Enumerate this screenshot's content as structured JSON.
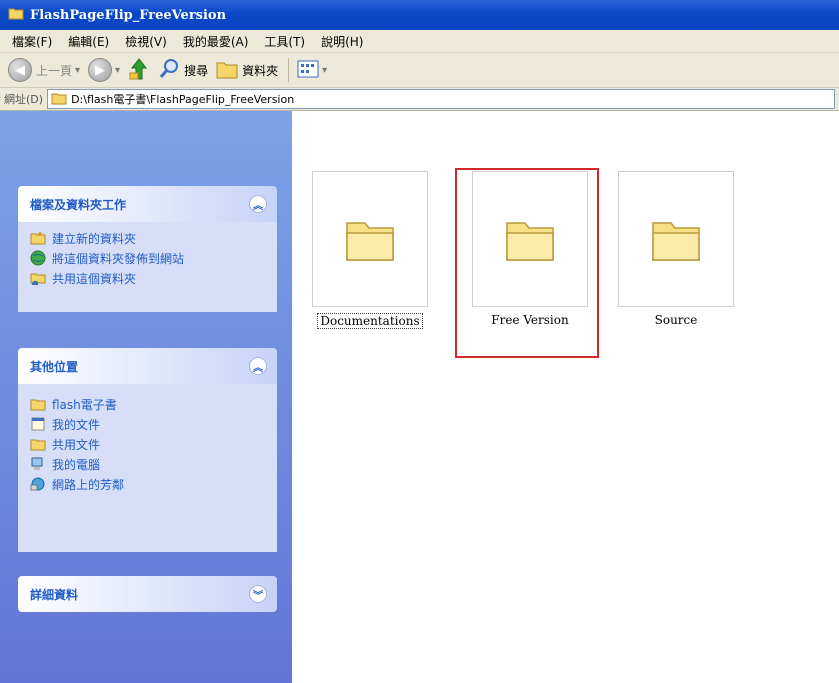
{
  "window": {
    "title": "FlashPageFlip_FreeVersion"
  },
  "menubar": {
    "items": [
      "檔案(F)",
      "編輯(E)",
      "檢視(V)",
      "我的最愛(A)",
      "工具(T)",
      "說明(H)"
    ]
  },
  "toolbar": {
    "back_label": "上一頁",
    "search_label": "搜尋",
    "folders_label": "資料夾"
  },
  "address": {
    "label": "網址(D)",
    "path": "D:\\flash電子書\\FlashPageFlip_FreeVersion"
  },
  "sidebar": {
    "tasks_panel": {
      "title": "檔案及資料夾工作",
      "items": [
        {
          "label": "建立新的資料夾",
          "icon": "new-folder-icon"
        },
        {
          "label": "將這個資料夾發佈到網站",
          "icon": "publish-web-icon"
        },
        {
          "label": "共用這個資料夾",
          "icon": "share-folder-icon"
        }
      ]
    },
    "places_panel": {
      "title": "其他位置",
      "items": [
        {
          "label": "flash電子書",
          "icon": "folder-icon"
        },
        {
          "label": "我的文件",
          "icon": "my-documents-icon"
        },
        {
          "label": "共用文件",
          "icon": "shared-documents-icon"
        },
        {
          "label": "我的電腦",
          "icon": "my-computer-icon"
        },
        {
          "label": "網路上的芳鄰",
          "icon": "network-places-icon"
        }
      ]
    },
    "details_panel": {
      "title": "詳細資料"
    }
  },
  "content": {
    "items": [
      {
        "name": "Documentations",
        "selected": true
      },
      {
        "name": "Free Version",
        "highlighted": true
      },
      {
        "name": "Source"
      }
    ]
  },
  "colors": {
    "title_bar": "#0a48c8",
    "sidebar": "#6b8ee0",
    "highlight": "#d12a2a"
  }
}
